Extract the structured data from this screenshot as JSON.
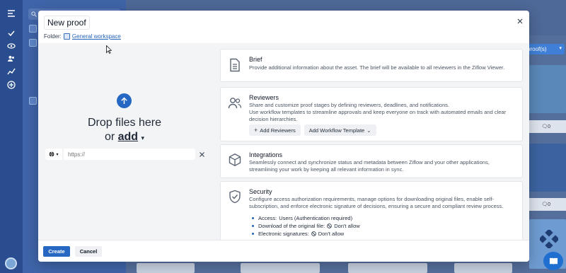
{
  "background": {
    "proof_button_label": "proof(s)",
    "comment_count_1": "0",
    "comment_count_2": "0"
  },
  "modal": {
    "title": "New proof",
    "folder_label": "Folder:",
    "folder_name": "General workspace",
    "dropzone": {
      "title": "Drop files here",
      "or_text": "or",
      "add_text": "add",
      "url_placeholder": "https://"
    },
    "sections": {
      "brief": {
        "title": "Brief",
        "description": "Provide additional information about the asset. The brief will be available to all reviewers in the Ziflow Viewer."
      },
      "reviewers": {
        "title": "Reviewers",
        "description_1": "Share and customize proof stages by defining reviewers, deadlines, and notifications.",
        "description_2": "Use workflow templates to streamline approvals and keep everyone on track with automated emails and clear decision hierarchies.",
        "add_reviewers_label": "Add Reviewers",
        "add_workflow_label": "Add Workflow Template"
      },
      "integrations": {
        "title": "Integrations",
        "description": "Seamlessly connect and synchronize status and metadata between Ziflow and your other applications, streamlining your work by keeping all relevant information in sync."
      },
      "security": {
        "title": "Security",
        "description": "Configure access authorization requirements, manage options for downloading original files, enable self-subscription, and enforce electronic signature of decisions, ensuring a secure and compliant review process.",
        "items": [
          {
            "label": "Access:",
            "value": "Users (Authentication required)"
          },
          {
            "label": "Download of the original file:",
            "value": "Don't allow"
          },
          {
            "label": "Electronic signatures:",
            "value": "Don't allow"
          }
        ]
      }
    },
    "footer": {
      "create_label": "Create",
      "cancel_label": "Cancel"
    }
  },
  "colors": {
    "primary": "#2767c4",
    "rail": "#2a4d8f",
    "link": "#2563b8"
  }
}
